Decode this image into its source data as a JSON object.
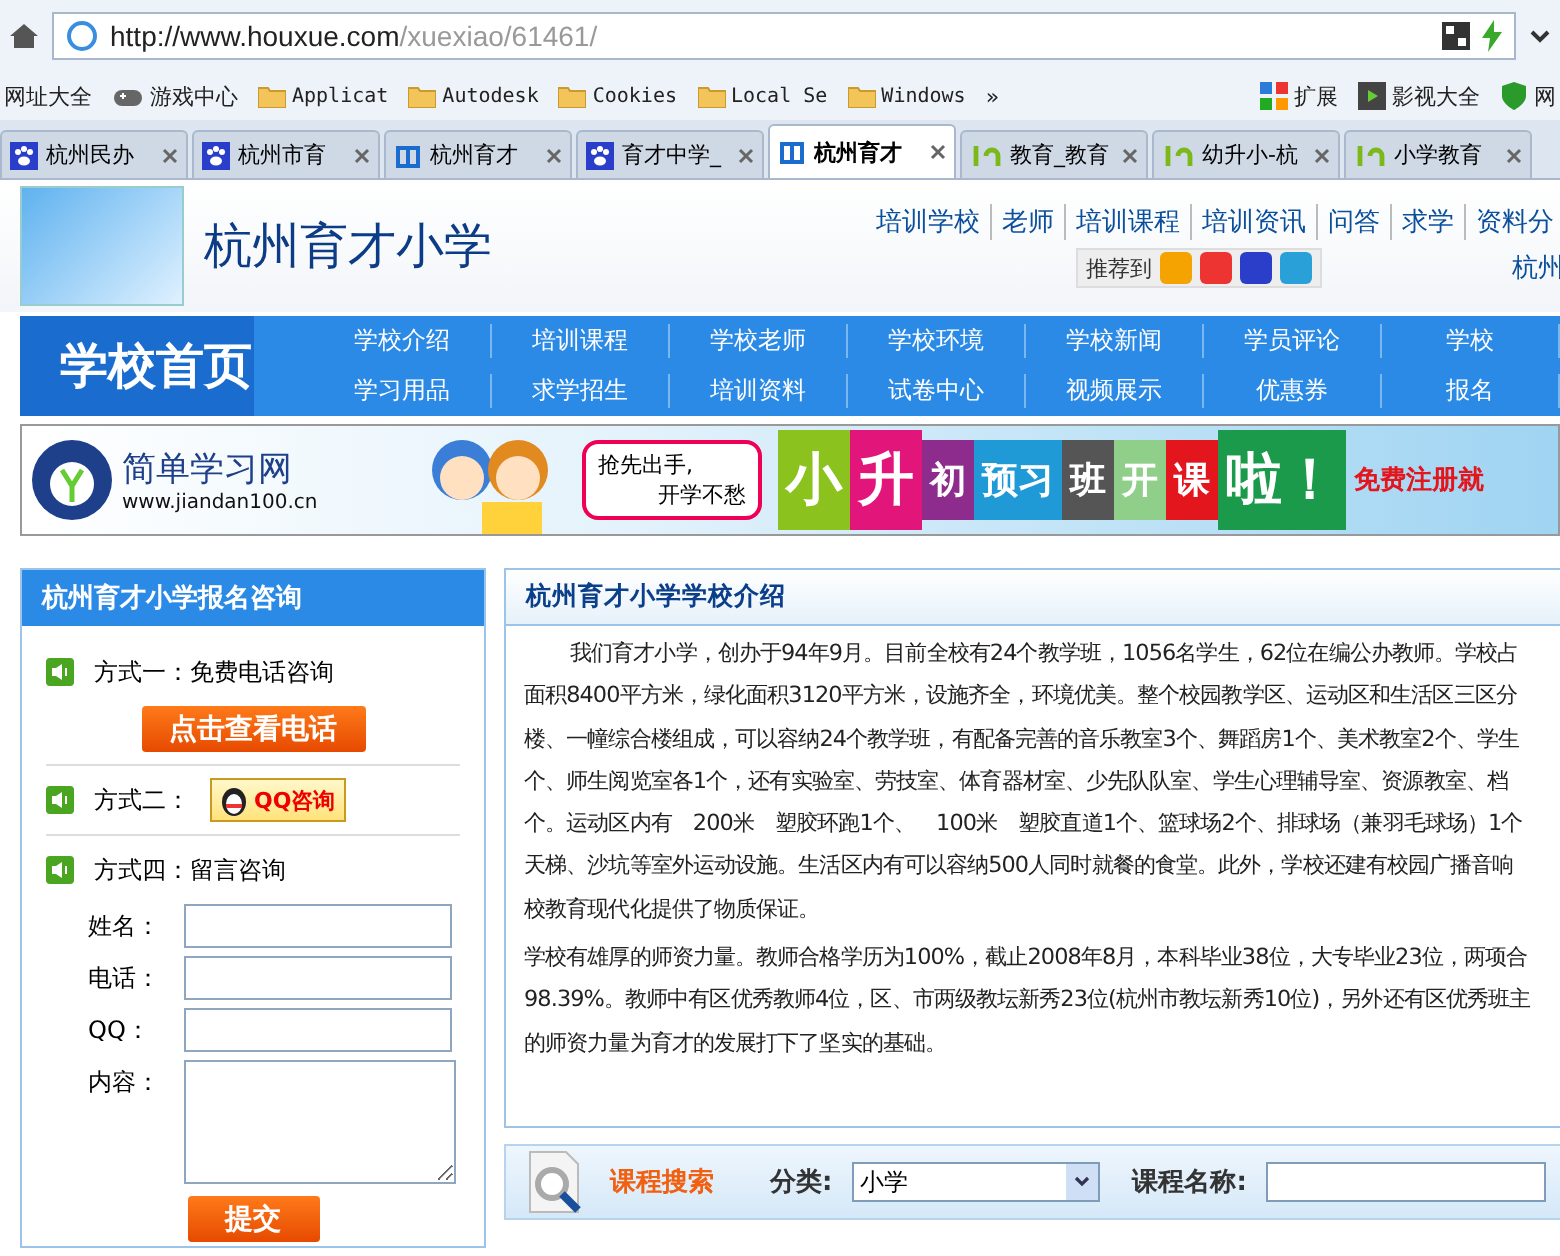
{
  "browser": {
    "url_host": "http://www.houxue.com",
    "url_path": "/xuexiao/61461/",
    "bookmarks": [
      {
        "label": "网址大全",
        "kind": "plain"
      },
      {
        "label": "游戏中心",
        "kind": "game"
      },
      {
        "label": "Applicat",
        "kind": "folder"
      },
      {
        "label": "Autodesk",
        "kind": "folder"
      },
      {
        "label": "Cookies",
        "kind": "folder"
      },
      {
        "label": "Local Se",
        "kind": "folder"
      },
      {
        "label": "Windows",
        "kind": "folder"
      }
    ],
    "more": "»",
    "extras": [
      {
        "label": "扩展",
        "kind": "apps"
      },
      {
        "label": "影视大全",
        "kind": "film"
      },
      {
        "label": "网",
        "kind": "shield"
      }
    ],
    "tabs": [
      {
        "label": "杭州民办",
        "kind": "paw",
        "selected": false
      },
      {
        "label": "杭州市育",
        "kind": "paw",
        "selected": false
      },
      {
        "label": "杭州育才",
        "kind": "xue",
        "selected": false
      },
      {
        "label": "育才中学_",
        "kind": "paw",
        "selected": false
      },
      {
        "label": "杭州育才",
        "kind": "xue",
        "selected": true
      },
      {
        "label": "教育_教育",
        "kind": "nineteen",
        "selected": false
      },
      {
        "label": "幼升小-杭",
        "kind": "nineteen",
        "selected": false
      },
      {
        "label": "小学教育",
        "kind": "nineteen",
        "selected": false
      }
    ]
  },
  "header": {
    "school_name": "杭州育才小学",
    "top_links": [
      "培训学校",
      "老师",
      "培训课程",
      "培训资讯",
      "问答",
      "求学",
      "资料分"
    ],
    "recommend_label": "推荐到",
    "city": "杭州"
  },
  "nav": {
    "home": "学校首页",
    "rows": [
      [
        "学校介绍",
        "培训课程",
        "学校老师",
        "学校环境",
        "学校新闻",
        "学员评论",
        "学校"
      ],
      [
        "学习用品",
        "求学招生",
        "培训资料",
        "试卷中心",
        "视频展示",
        "优惠券",
        "报名"
      ]
    ]
  },
  "banner": {
    "brand": "简单学习网",
    "site": "www.jiandan100.cn",
    "bubble": [
      "抢先出手,",
      "开学不愁"
    ],
    "tiles": [
      {
        "text": "小",
        "color": "#8cc21e"
      },
      {
        "text": "升",
        "color": "#e2157a"
      },
      {
        "text": "初",
        "color": "#8e2c8e"
      },
      {
        "text": "预习",
        "color": "#1f9ad6"
      },
      {
        "text": "班",
        "color": "#555555"
      },
      {
        "text": "开",
        "color": "#8fcf8a"
      },
      {
        "text": "课",
        "color": "#e3161e"
      },
      {
        "text": "啦！",
        "color": "#1a9a4a"
      }
    ],
    "cta": "免费注册就"
  },
  "consult": {
    "title": "杭州育才小学报名咨询",
    "method1": "方式一：免费电话咨询",
    "phone_button": "点击查看电话",
    "method2": "方式二：",
    "qq_button": "QQ咨询",
    "method4": "方式四：留言咨询",
    "fields": [
      {
        "label": "姓名：",
        "kind": "input"
      },
      {
        "label": "电话：",
        "kind": "input"
      },
      {
        "label": "QQ：",
        "kind": "input"
      },
      {
        "label": "内容：",
        "kind": "textarea"
      }
    ],
    "submit": "提交"
  },
  "intro": {
    "title": "杭州育才小学学校介绍",
    "paragraphs": [
      [
        "我们育才小学，创办于94年9月。目前全校有24个教学班，1056名学生，62位在编公办教师。学校占",
        "面积8400平方米，绿化面积3120平方米，设施齐全，环境优美。整个校园教学区、运动区和生活区三区分",
        "楼、一幢综合楼组成，可以容纳24个教学班，有配备完善的音乐教室3个、舞蹈房1个、美术教室2个、学生",
        "个、师生阅览室各1个，还有实验室、劳技室、体育器材室、少先队队室、学生心理辅导室、资源教室、档",
        "个。运动区内有　200米　塑胶环跑1个、　100米　塑胶直道1个、篮球场2个、排球场（兼羽毛球场）1个",
        "天梯、沙坑等室外运动设施。生活区内有可以容纳500人同时就餐的食堂。此外，学校还建有校园广播音响",
        "校教育现代化提供了物质保证。"
      ],
      [
        "学校有雄厚的师资力量。教师合格学历为100%，截止2008年8月，本科毕业38位，大专毕业23位，两项合",
        "98.39%。教师中有区优秀教师4位，区、市两级教坛新秀23位(杭州市教坛新秀10位)，另外还有区优秀班主",
        "的师资力量为育才的发展打下了坚实的基础。"
      ]
    ]
  },
  "search": {
    "title": "课程搜索",
    "category_label": "分类:",
    "category_value": "小学",
    "name_label": "课程名称:"
  }
}
